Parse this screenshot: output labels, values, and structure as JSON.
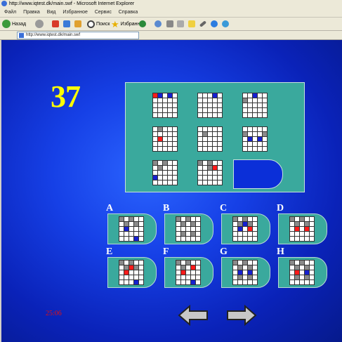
{
  "window": {
    "title": "http://www.iqtest.dk/main.swf - Microsoft Internet Explorer"
  },
  "menu": [
    "Файл",
    "Правка",
    "Вид",
    "Избранное",
    "Сервис",
    "Справка"
  ],
  "toolbar": {
    "back_label": "Назад",
    "search_label": "Поиск",
    "favorites_label": "Избранное"
  },
  "address": {
    "value": "http://www.iqtest.dk/main.swf"
  },
  "question": {
    "number": "37"
  },
  "timer": {
    "value": "25:06"
  },
  "matrix": [
    {
      "cells": [
        [
          "r",
          "b",
          "w",
          "b",
          "w"
        ],
        [
          "w",
          "w",
          "w",
          "w",
          "w"
        ],
        [
          "w",
          "w",
          "w",
          "w",
          "w"
        ],
        [
          "w",
          "w",
          "w",
          "w",
          "w"
        ],
        [
          "w",
          "w",
          "w",
          "w",
          "w"
        ]
      ]
    },
    {
      "cells": [
        [
          "w",
          "w",
          "w",
          "b",
          "w"
        ],
        [
          "w",
          "w",
          "w",
          "w",
          "w"
        ],
        [
          "w",
          "w",
          "w",
          "w",
          "w"
        ],
        [
          "w",
          "w",
          "w",
          "w",
          "w"
        ],
        [
          "w",
          "w",
          "w",
          "w",
          "w"
        ]
      ]
    },
    {
      "cells": [
        [
          "w",
          "w",
          "b",
          "w",
          "w"
        ],
        [
          "g",
          "w",
          "w",
          "w",
          "w"
        ],
        [
          "w",
          "w",
          "w",
          "w",
          "w"
        ],
        [
          "w",
          "w",
          "w",
          "w",
          "w"
        ],
        [
          "w",
          "w",
          "w",
          "w",
          "w"
        ]
      ]
    },
    {
      "cells": [
        [
          "w",
          "g",
          "w",
          "w",
          "w"
        ],
        [
          "w",
          "w",
          "w",
          "w",
          "w"
        ],
        [
          "w",
          "r",
          "w",
          "w",
          "w"
        ],
        [
          "w",
          "w",
          "w",
          "w",
          "w"
        ],
        [
          "w",
          "w",
          "w",
          "w",
          "w"
        ]
      ]
    },
    {
      "cells": [
        [
          "w",
          "w",
          "w",
          "w",
          "w"
        ],
        [
          "w",
          "g",
          "w",
          "w",
          "w"
        ],
        [
          "w",
          "w",
          "w",
          "w",
          "w"
        ],
        [
          "w",
          "w",
          "w",
          "w",
          "w"
        ],
        [
          "w",
          "w",
          "w",
          "w",
          "w"
        ]
      ]
    },
    {
      "cells": [
        [
          "w",
          "w",
          "w",
          "w",
          "w"
        ],
        [
          "g",
          "w",
          "w",
          "w",
          "g"
        ],
        [
          "w",
          "b",
          "w",
          "b",
          "w"
        ],
        [
          "w",
          "w",
          "w",
          "w",
          "w"
        ],
        [
          "w",
          "w",
          "w",
          "w",
          "w"
        ]
      ]
    },
    {
      "cells": [
        [
          "g",
          "w",
          "g",
          "w",
          "w"
        ],
        [
          "w",
          "g",
          "w",
          "w",
          "w"
        ],
        [
          "w",
          "w",
          "w",
          "w",
          "w"
        ],
        [
          "b",
          "w",
          "w",
          "w",
          "w"
        ],
        [
          "w",
          "w",
          "w",
          "w",
          "w"
        ]
      ]
    },
    {
      "cells": [
        [
          "g",
          "w",
          "g",
          "w",
          "w"
        ],
        [
          "w",
          "w",
          "g",
          "r",
          "w"
        ],
        [
          "w",
          "w",
          "w",
          "w",
          "w"
        ],
        [
          "w",
          "w",
          "w",
          "w",
          "w"
        ],
        [
          "w",
          "w",
          "w",
          "w",
          "w"
        ]
      ]
    }
  ],
  "options": [
    {
      "label": "A",
      "cells": [
        [
          "g",
          "w",
          "g",
          "w",
          "w"
        ],
        [
          "w",
          "g",
          "w",
          "g",
          "w"
        ],
        [
          "w",
          "b",
          "w",
          "w",
          "w"
        ],
        [
          "w",
          "w",
          "w",
          "w",
          "w"
        ],
        [
          "w",
          "w",
          "w",
          "b",
          "w"
        ]
      ]
    },
    {
      "label": "B",
      "cells": [
        [
          "g",
          "w",
          "g",
          "w",
          "w"
        ],
        [
          "w",
          "g",
          "w",
          "g",
          "w"
        ],
        [
          "w",
          "w",
          "w",
          "w",
          "w"
        ],
        [
          "w",
          "g",
          "w",
          "g",
          "w"
        ],
        [
          "w",
          "w",
          "w",
          "w",
          "w"
        ]
      ]
    },
    {
      "label": "C",
      "cells": [
        [
          "g",
          "w",
          "g",
          "w",
          "w"
        ],
        [
          "w",
          "g",
          "b",
          "g",
          "w"
        ],
        [
          "w",
          "b",
          "w",
          "r",
          "w"
        ],
        [
          "w",
          "w",
          "w",
          "w",
          "w"
        ],
        [
          "w",
          "w",
          "w",
          "w",
          "w"
        ]
      ]
    },
    {
      "label": "D",
      "cells": [
        [
          "g",
          "w",
          "g",
          "w",
          "w"
        ],
        [
          "w",
          "g",
          "w",
          "g",
          "w"
        ],
        [
          "w",
          "r",
          "w",
          "r",
          "w"
        ],
        [
          "w",
          "w",
          "w",
          "w",
          "w"
        ],
        [
          "w",
          "w",
          "w",
          "w",
          "w"
        ]
      ]
    },
    {
      "label": "E",
      "cells": [
        [
          "g",
          "w",
          "g",
          "w",
          "w"
        ],
        [
          "w",
          "g",
          "r",
          "g",
          "w"
        ],
        [
          "w",
          "r",
          "w",
          "w",
          "w"
        ],
        [
          "w",
          "w",
          "w",
          "w",
          "w"
        ],
        [
          "w",
          "w",
          "w",
          "b",
          "w"
        ]
      ]
    },
    {
      "label": "F",
      "cells": [
        [
          "g",
          "w",
          "g",
          "w",
          "w"
        ],
        [
          "w",
          "g",
          "w",
          "r",
          "w"
        ],
        [
          "w",
          "r",
          "w",
          "w",
          "w"
        ],
        [
          "w",
          "w",
          "w",
          "w",
          "w"
        ],
        [
          "w",
          "w",
          "w",
          "b",
          "w"
        ]
      ]
    },
    {
      "label": "G",
      "cells": [
        [
          "g",
          "w",
          "g",
          "w",
          "w"
        ],
        [
          "w",
          "g",
          "w",
          "g",
          "w"
        ],
        [
          "w",
          "b",
          "w",
          "b",
          "w"
        ],
        [
          "w",
          "g",
          "w",
          "g",
          "w"
        ],
        [
          "w",
          "w",
          "w",
          "w",
          "w"
        ]
      ]
    },
    {
      "label": "H",
      "cells": [
        [
          "g",
          "w",
          "g",
          "w",
          "w"
        ],
        [
          "w",
          "g",
          "w",
          "g",
          "w"
        ],
        [
          "w",
          "r",
          "w",
          "b",
          "w"
        ],
        [
          "w",
          "g",
          "w",
          "g",
          "w"
        ],
        [
          "w",
          "w",
          "w",
          "w",
          "w"
        ]
      ]
    }
  ],
  "nav": {
    "prev_icon": "arrow-left-icon",
    "next_icon": "arrow-right-icon"
  },
  "colors": {
    "panel": "#3aa99d",
    "background": "#1640e6",
    "number": "#ffff00",
    "timer": "#e21010"
  }
}
